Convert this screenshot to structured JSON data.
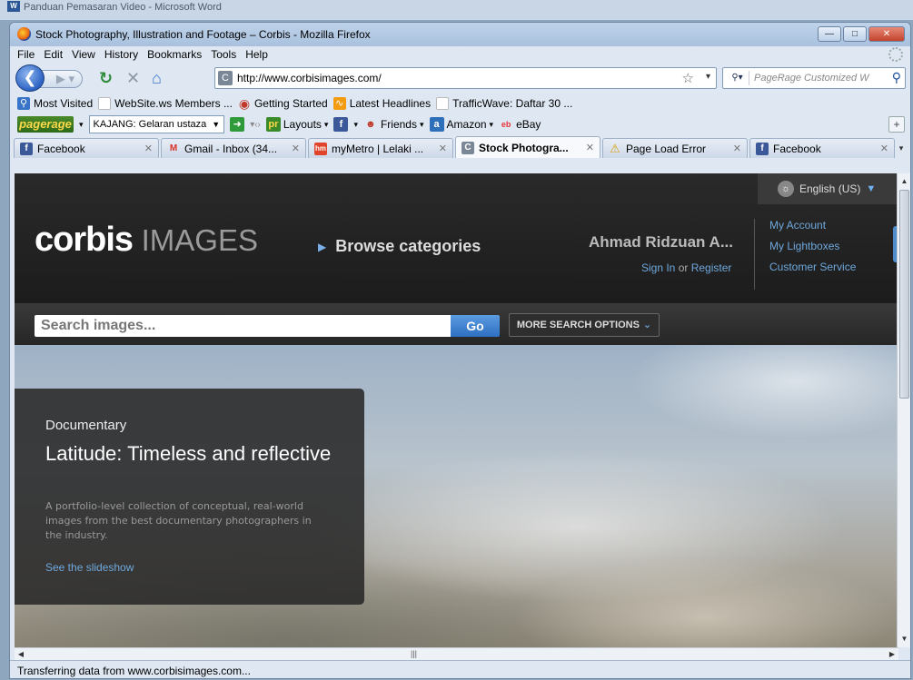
{
  "background_window": {
    "title": "Panduan Pemasaran Video - Microsoft Word"
  },
  "window": {
    "title": "Stock Photography, Illustration and Footage – Corbis - Mozilla Firefox",
    "buttons": {
      "minimize": "—",
      "maximize": "□",
      "close": "✕"
    }
  },
  "menu": [
    "File",
    "Edit",
    "View",
    "History",
    "Bookmarks",
    "Tools",
    "Help"
  ],
  "nav": {
    "url": "http://www.corbisimages.com/",
    "search_placeholder": "PageRage Customized W"
  },
  "bookmarks": [
    {
      "label": "Most Visited",
      "icon": "search-page-icon",
      "color": "#3a74c8"
    },
    {
      "label": "WebSite.ws Members ...",
      "icon": "page-icon",
      "color": "#cccccc"
    },
    {
      "label": "Getting Started",
      "icon": "firefox-icon",
      "color": "#c0392b"
    },
    {
      "label": "Latest Headlines",
      "icon": "rss-icon",
      "color": "#f39c12"
    },
    {
      "label": "TrafficWave: Daftar 30 ...",
      "icon": "page-icon",
      "color": "#cccccc"
    }
  ],
  "toolbar2": {
    "logo": "pagerage",
    "combo": "KAJANG: Gelaran ustaza",
    "layouts": "Layouts",
    "friends": "Friends",
    "amazon": "Amazon",
    "ebay": "eBay",
    "plus": "+"
  },
  "tabs": [
    {
      "label": "Facebook",
      "icon": "f",
      "icon_color": "#3b5998",
      "active": false
    },
    {
      "label": "Gmail - Inbox (34...",
      "icon": "M",
      "icon_color": "#d93025",
      "active": false
    },
    {
      "label": "myMetro | Lelaki ...",
      "icon": "hm",
      "icon_color": "#e0452b",
      "active": false
    },
    {
      "label": "Stock Photogra...",
      "icon": "C",
      "icon_color": "#7a8796",
      "active": true
    },
    {
      "label": "Page Load Error",
      "icon": "!",
      "icon_color": "#f1c40f",
      "active": false
    },
    {
      "label": "Facebook",
      "icon": "f",
      "icon_color": "#3b5998",
      "active": false
    }
  ],
  "corbis": {
    "language": "English (US)",
    "logo_main": "corbis",
    "logo_sub": "IMAGES",
    "browse": "Browse categories",
    "user": "Ahmad Ridzuan A...",
    "sign_in": "Sign In",
    "or": "or",
    "register": "Register",
    "account_links": [
      "My Account",
      "My Lightboxes",
      "Customer Service"
    ],
    "search_placeholder": "Search images...",
    "go": "Go",
    "more_options": "MORE SEARCH OPTIONS"
  },
  "promo": {
    "category": "Documentary",
    "title": "Latitude: Timeless and reflective",
    "description": "A portfolio-level collection of conceptual, real-world images from the best documentary photographers in the industry.",
    "link": "See the slideshow"
  },
  "status": "Transferring data from www.corbisimages.com..."
}
